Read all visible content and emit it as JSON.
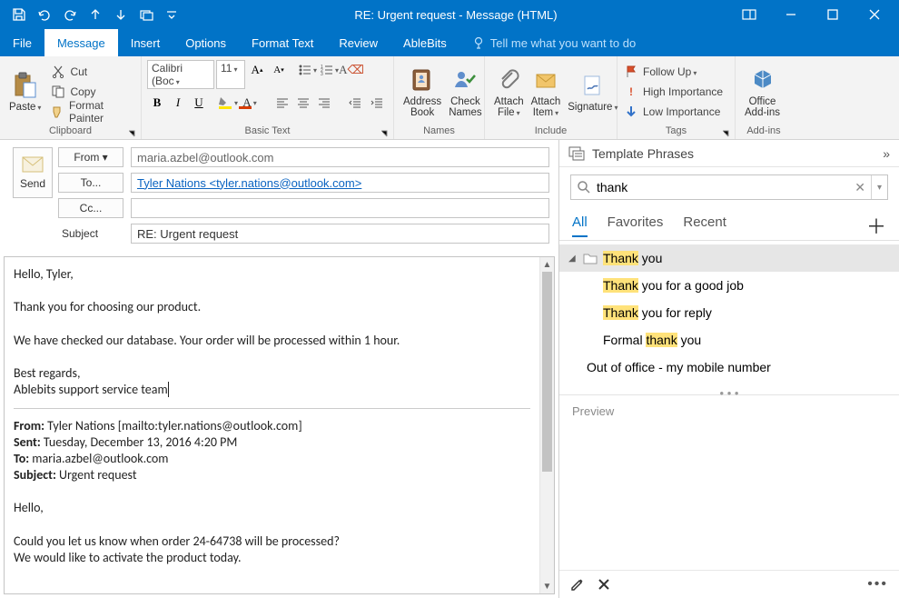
{
  "window": {
    "title": "RE: Urgent request  -  Message (HTML)"
  },
  "menu": {
    "file": "File",
    "message": "Message",
    "insert": "Insert",
    "options": "Options",
    "format_text": "Format Text",
    "review": "Review",
    "ablebits": "AbleBits",
    "tellme": "Tell me what you want to do"
  },
  "ribbon": {
    "clipboard": {
      "label": "Clipboard",
      "paste": "Paste",
      "cut": "Cut",
      "copy": "Copy",
      "format_painter": "Format Painter"
    },
    "basic_text": {
      "label": "Basic Text",
      "font_name": "Calibri (Boc",
      "font_size": "11"
    },
    "names": {
      "label": "Names",
      "address_book": "Address\nBook",
      "check_names": "Check\nNames"
    },
    "include": {
      "label": "Include",
      "attach_file": "Attach\nFile",
      "attach_item": "Attach\nItem",
      "signature": "Signature"
    },
    "tags": {
      "label": "Tags",
      "follow_up": "Follow Up",
      "high_importance": "High Importance",
      "low_importance": "Low Importance"
    },
    "addins": {
      "label": "Add-ins",
      "office_addins": "Office\nAdd-ins"
    }
  },
  "compose": {
    "send": "Send",
    "from_label": "From",
    "from_value": "maria.azbel@outlook.com",
    "to_label": "To...",
    "to_value": "Tyler Nations  <tyler.nations@outlook.com>",
    "cc_label": "Cc...",
    "cc_value": "",
    "subject_label": "Subject",
    "subject_value": "RE: Urgent request",
    "body": {
      "greeting": "Hello, Tyler,",
      "p1": "Thank you for choosing our product.",
      "p2": "We have checked our database. Your order will be processed within 1 hour.",
      "sign1": "Best regards,",
      "sign2": "Ablebits support service team ",
      "q_from_label": "From:",
      "q_from": " Tyler Nations [mailto:tyler.nations@outlook.com]",
      "q_sent_label": "Sent:",
      "q_sent": " Tuesday, December 13, 2016 4:20 PM",
      "q_to_label": "To:",
      "q_to": " maria.azbel@outlook.com",
      "q_subject_label": "Subject:",
      "q_subject": " Urgent request",
      "q_greeting": "Hello,",
      "q_p1": "Could you let us know when order 24-64738 will be processed?",
      "q_p2": "We would like to activate the product today."
    }
  },
  "pane": {
    "title": "Template Phrases",
    "search_value": "thank",
    "tabs": {
      "all": "All",
      "favorites": "Favorites",
      "recent": "Recent"
    },
    "items": [
      {
        "highlight": "Thank",
        "rest": " you"
      },
      {
        "highlight": "Thank",
        "rest": " you for a good job"
      },
      {
        "highlight": "Thank",
        "rest": " you for reply"
      },
      {
        "pre": "Formal ",
        "highlight": "thank",
        "rest": " you"
      }
    ],
    "extra_item": "Out of office - my mobile number",
    "sep_dots": "• • •",
    "preview": "Preview"
  }
}
